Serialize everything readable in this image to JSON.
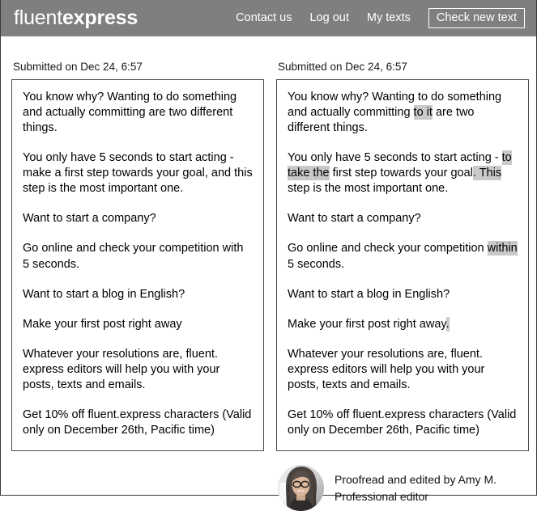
{
  "header": {
    "logo_light": "fluent",
    "logo_bold": "express",
    "nav": [
      {
        "label": "Contact us",
        "name": "nav-contact-us"
      },
      {
        "label": "Log out",
        "name": "nav-log-out"
      },
      {
        "label": "My texts",
        "name": "nav-my-texts"
      }
    ],
    "cta_label": "Check new text",
    "background_color": "#7f7f7f",
    "text_color": "#ffffff"
  },
  "original": {
    "submitted_label": "Submitted on Dec 24, 6:57",
    "paragraphs": [
      "You know why? Wanting to do something and actually committing are two different things.",
      "You only have 5 seconds to start acting - make a first step towards your goal, and this step is the most important one.",
      "Want to start a company?",
      "Go online and check your competition with 5 seconds.",
      "Want to start a blog in English?",
      "Make your first post right away",
      "Whatever your resolutions are, fluent. express editors will help you with your posts, texts and emails.",
      "Get 10% off fluent.express characters (Valid only on December 26th, Pacific time)"
    ]
  },
  "corrected": {
    "submitted_label": "Submitted on Dec 24, 6:57",
    "highlight_color": "#c9c9c9",
    "paragraphs": [
      {
        "segments": [
          {
            "text": "You know why? Wanting to do something and actually committing ",
            "highlight": false
          },
          {
            "text": "to it",
            "highlight": true
          },
          {
            "text": " are two different things.",
            "highlight": false
          }
        ]
      },
      {
        "segments": [
          {
            "text": "You only have 5 seconds to start acting - ",
            "highlight": false
          },
          {
            "text": "to take the",
            "highlight": true
          },
          {
            "text": " first step towards your goal",
            "highlight": false
          },
          {
            "text": ". This",
            "highlight": true
          },
          {
            "text": " step is the most important one.",
            "highlight": false
          }
        ]
      },
      {
        "segments": [
          {
            "text": "Want to start a company?",
            "highlight": false
          }
        ]
      },
      {
        "segments": [
          {
            "text": "Go online and check your competition ",
            "highlight": false
          },
          {
            "text": "within",
            "highlight": true
          },
          {
            "text": " 5 seconds.",
            "highlight": false
          }
        ]
      },
      {
        "segments": [
          {
            "text": "Want to start a blog in English?",
            "highlight": false
          }
        ]
      },
      {
        "segments": [
          {
            "text": "Make your first post right away",
            "highlight": false
          },
          {
            "text": ".",
            "highlight": true
          }
        ]
      },
      {
        "segments": [
          {
            "text": "Whatever your resolutions are, fluent. express editors will help you with your posts, texts and emails.",
            "highlight": false
          }
        ]
      },
      {
        "segments": [
          {
            "text": "Get 10% off fluent.express characters (Valid only on December 26th, Pacific time)",
            "highlight": false
          }
        ]
      }
    ]
  },
  "editor": {
    "avatar_alt": "editor-avatar-photo",
    "name_line": "Proofread and edited by Amy M.",
    "role_line": "Professional editor"
  }
}
